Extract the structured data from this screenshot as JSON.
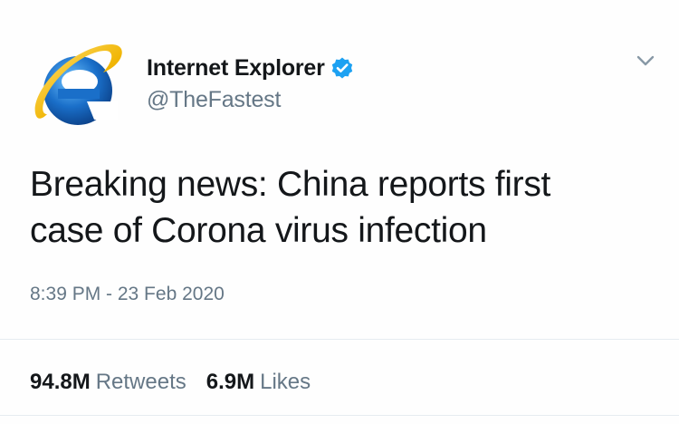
{
  "author": {
    "display_name": "Internet Explorer",
    "handle": "@TheFastest",
    "verified": true,
    "avatar_icon": "internet-explorer-logo-icon"
  },
  "tweet": {
    "text_line1": "Breaking news: China reports first",
    "text_line2": "case of Corona virus infection",
    "timestamp": "8:39 PM - 23 Feb 2020"
  },
  "stats": {
    "retweets_count": "94.8M",
    "retweets_label": "Retweets",
    "likes_count": "6.9M",
    "likes_label": "Likes"
  },
  "colors": {
    "verified_blue": "#1da1f2",
    "ie_blue": "#1a6fc9",
    "ie_ring_gold": "#f0b400",
    "muted_text": "#657786"
  }
}
